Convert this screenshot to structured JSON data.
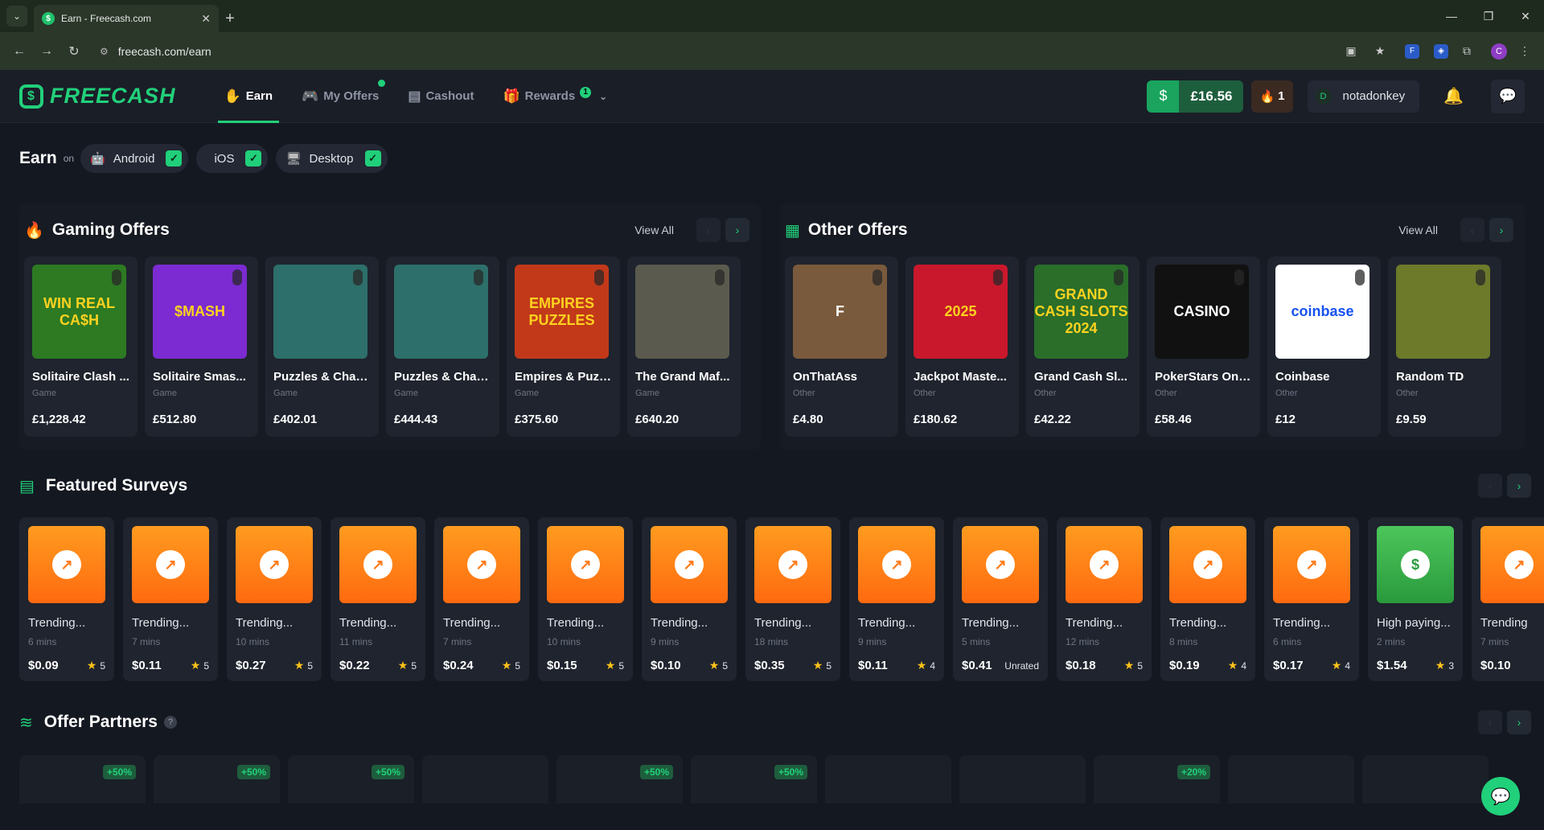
{
  "browser": {
    "tab_title": "Earn - Freecash.com",
    "url": "freecash.com/earn",
    "avatar_letter": "C"
  },
  "header": {
    "logo": "FREECASH",
    "nav": [
      {
        "label": "Earn",
        "icon": "hand-coin-icon",
        "active": true
      },
      {
        "label": "My Offers",
        "icon": "gamepad-icon",
        "dot": true
      },
      {
        "label": "Cashout",
        "icon": "cashout-icon"
      },
      {
        "label": "Rewards",
        "icon": "gift-icon",
        "badge": "1"
      }
    ],
    "balance": "£16.56",
    "streak": "1",
    "user_initial": "D",
    "username": "notadonkey"
  },
  "earn_filter": {
    "title": "Earn",
    "on": "on",
    "platforms": [
      "Android",
      "iOS",
      "Desktop"
    ]
  },
  "gaming_offers": {
    "title": "Gaming Offers",
    "view_all": "View All",
    "items": [
      {
        "name": "Solitaire Clash ...",
        "cat": "Game",
        "price": "£1,228.42",
        "thumb_text": "WIN REAL CA$H",
        "bg": "#2d7a23",
        "fg": "#ffd21f"
      },
      {
        "name": "Solitaire Smas...",
        "cat": "Game",
        "price": "£512.80",
        "thumb_text": "$MASH",
        "bg": "#7b2bd1",
        "fg": "#ffd21f"
      },
      {
        "name": "Puzzles & Chao...",
        "cat": "Game",
        "price": "£402.01",
        "thumb_text": "",
        "bg": "#2d6f6a",
        "fg": "#fff"
      },
      {
        "name": "Puzzles & Chao...",
        "cat": "Game",
        "price": "£444.43",
        "thumb_text": "",
        "bg": "#2d6f6a",
        "fg": "#fff"
      },
      {
        "name": "Empires & Puzz...",
        "cat": "Game",
        "price": "£375.60",
        "thumb_text": "EMPIRES PUZZLES",
        "bg": "#c2391a",
        "fg": "#ffd21f"
      },
      {
        "name": "The Grand Maf...",
        "cat": "Game",
        "price": "£640.20",
        "thumb_text": "",
        "bg": "#5b5a4e",
        "fg": "#fff"
      }
    ]
  },
  "other_offers": {
    "title": "Other Offers",
    "view_all": "View All",
    "items": [
      {
        "name": "OnThatAss",
        "cat": "Other",
        "price": "£4.80",
        "thumb_text": "F",
        "bg": "#7a5a3c",
        "fg": "#fff"
      },
      {
        "name": "Jackpot Maste...",
        "cat": "Other",
        "price": "£180.62",
        "thumb_text": "2025",
        "bg": "#c9182c",
        "fg": "#ffd21f"
      },
      {
        "name": "Grand Cash Sl...",
        "cat": "Other",
        "price": "£42.22",
        "thumb_text": "GRAND CASH SLOTS 2024",
        "bg": "#2a6e2a",
        "fg": "#ffd21f"
      },
      {
        "name": "PokerStars Onli...",
        "cat": "Other",
        "price": "£58.46",
        "thumb_text": "CASINO",
        "bg": "#111",
        "fg": "#fff"
      },
      {
        "name": "Coinbase",
        "cat": "Other",
        "price": "£12",
        "thumb_text": "coinbase",
        "bg": "#ffffff",
        "fg": "#1652f0"
      },
      {
        "name": "Random TD",
        "cat": "Other",
        "price": "£9.59",
        "thumb_text": "",
        "bg": "#6c7a2a",
        "fg": "#fff"
      }
    ]
  },
  "featured_surveys": {
    "title": "Featured Surveys",
    "items": [
      {
        "title": "Trending...",
        "mins": "6 mins",
        "price": "$0.09",
        "rating": "5"
      },
      {
        "title": "Trending...",
        "mins": "7 mins",
        "price": "$0.11",
        "rating": "5"
      },
      {
        "title": "Trending...",
        "mins": "10 mins",
        "price": "$0.27",
        "rating": "5"
      },
      {
        "title": "Trending...",
        "mins": "11 mins",
        "price": "$0.22",
        "rating": "5"
      },
      {
        "title": "Trending...",
        "mins": "7 mins",
        "price": "$0.24",
        "rating": "5"
      },
      {
        "title": "Trending...",
        "mins": "10 mins",
        "price": "$0.15",
        "rating": "5"
      },
      {
        "title": "Trending...",
        "mins": "9 mins",
        "price": "$0.10",
        "rating": "5"
      },
      {
        "title": "Trending...",
        "mins": "18 mins",
        "price": "$0.35",
        "rating": "5"
      },
      {
        "title": "Trending...",
        "mins": "9 mins",
        "price": "$0.11",
        "rating": "4"
      },
      {
        "title": "Trending...",
        "mins": "5 mins",
        "price": "$0.41",
        "rating": "Unrated"
      },
      {
        "title": "Trending...",
        "mins": "12 mins",
        "price": "$0.18",
        "rating": "5"
      },
      {
        "title": "Trending...",
        "mins": "8 mins",
        "price": "$0.19",
        "rating": "4"
      },
      {
        "title": "Trending...",
        "mins": "6 mins",
        "price": "$0.17",
        "rating": "4"
      },
      {
        "title": "High paying...",
        "mins": "2 mins",
        "price": "$1.54",
        "rating": "3",
        "green": true
      },
      {
        "title": "Trending",
        "mins": "7 mins",
        "price": "$0.10",
        "rating": ""
      }
    ]
  },
  "offer_partners": {
    "title": "Offer Partners",
    "badges": [
      "+50%",
      "+50%",
      "+50%",
      "",
      "+50%",
      "+50%",
      "",
      "",
      "+20%",
      "",
      ""
    ]
  },
  "colors": {
    "accent": "#21d07a",
    "bg": "#141821",
    "card": "#1f242e",
    "orange": "#ff7a1a"
  }
}
